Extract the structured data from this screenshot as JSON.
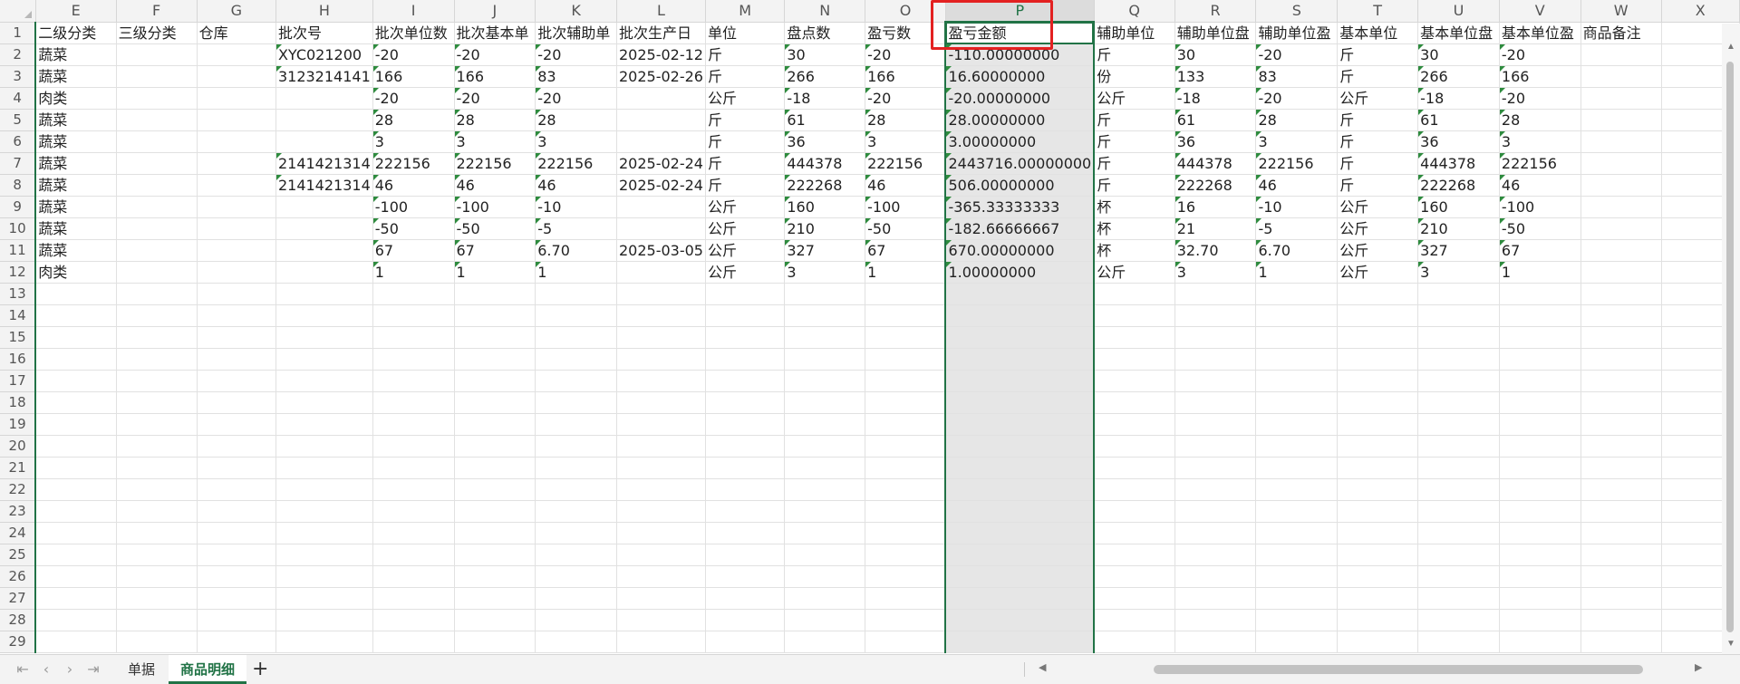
{
  "columns": [
    "E",
    "F",
    "G",
    "H",
    "I",
    "J",
    "K",
    "L",
    "M",
    "N",
    "O",
    "P",
    "Q",
    "R",
    "S",
    "T",
    "U",
    "V",
    "W",
    "X"
  ],
  "selected_column": "P",
  "header_row": [
    "二级分类",
    "三级分类",
    "仓库",
    "批次号",
    "批次单位数",
    "批次基本单",
    "批次辅助单",
    "批次生产日",
    "单位",
    "盘点数",
    "盈亏数",
    "盈亏金额",
    "辅助单位",
    "辅助单位盘",
    "辅助单位盈",
    "基本单位",
    "基本单位盘",
    "基本单位盈",
    "商品备注",
    ""
  ],
  "rows": [
    [
      "蔬菜",
      "",
      "",
      "XYC021200",
      "-20",
      "-20",
      "-20",
      "2025-02-12",
      "斤",
      "30",
      "-20",
      "-110.00000000",
      "斤",
      "30",
      "-20",
      "斤",
      "30",
      "-20",
      "",
      ""
    ],
    [
      "蔬菜",
      "",
      "",
      "3123214141",
      "166",
      "166",
      "83",
      "2025-02-26",
      "斤",
      "266",
      "166",
      "16.60000000",
      "份",
      "133",
      "83",
      "斤",
      "266",
      "166",
      "",
      ""
    ],
    [
      "肉类",
      "",
      "",
      "",
      "-20",
      "-20",
      "-20",
      "",
      "公斤",
      "-18",
      "-20",
      "-20.00000000",
      "公斤",
      "-18",
      "-20",
      "公斤",
      "-18",
      "-20",
      "",
      ""
    ],
    [
      "蔬菜",
      "",
      "",
      "",
      "28",
      "28",
      "28",
      "",
      "斤",
      "61",
      "28",
      "28.00000000",
      "斤",
      "61",
      "28",
      "斤",
      "61",
      "28",
      "",
      ""
    ],
    [
      "蔬菜",
      "",
      "",
      "",
      "3",
      "3",
      "3",
      "",
      "斤",
      "36",
      "3",
      "3.00000000",
      "斤",
      "36",
      "3",
      "斤",
      "36",
      "3",
      "",
      ""
    ],
    [
      "蔬菜",
      "",
      "",
      "2141421314",
      "222156",
      "222156",
      "222156",
      "2025-02-24",
      "斤",
      "444378",
      "222156",
      "2443716.00000000",
      "斤",
      "444378",
      "222156",
      "斤",
      "444378",
      "222156",
      "",
      ""
    ],
    [
      "蔬菜",
      "",
      "",
      "2141421314",
      "46",
      "46",
      "46",
      "2025-02-24",
      "斤",
      "222268",
      "46",
      "506.00000000",
      "斤",
      "222268",
      "46",
      "斤",
      "222268",
      "46",
      "",
      ""
    ],
    [
      "蔬菜",
      "",
      "",
      "",
      "-100",
      "-100",
      "-10",
      "",
      "公斤",
      "160",
      "-100",
      "-365.33333333",
      "杯",
      "16",
      "-10",
      "公斤",
      "160",
      "-100",
      "",
      ""
    ],
    [
      "蔬菜",
      "",
      "",
      "",
      "-50",
      "-50",
      "-5",
      "",
      "公斤",
      "210",
      "-50",
      "-182.66666667",
      "杯",
      "21",
      "-5",
      "公斤",
      "210",
      "-50",
      "",
      ""
    ],
    [
      "蔬菜",
      "",
      "",
      "",
      "67",
      "67",
      "6.70",
      "2025-03-05",
      "公斤",
      "327",
      "67",
      "670.00000000",
      "杯",
      "32.70",
      "6.70",
      "公斤",
      "327",
      "67",
      "",
      ""
    ],
    [
      "肉类",
      "",
      "",
      "",
      "1",
      "1",
      "1",
      "",
      "公斤",
      "3",
      "1",
      "1.00000000",
      "公斤",
      "3",
      "1",
      "公斤",
      "3",
      "1",
      "",
      ""
    ]
  ],
  "row_numbers": [
    "1",
    "2",
    "3",
    "4",
    "5",
    "6",
    "7",
    "8",
    "9",
    "10",
    "11",
    "12",
    "13",
    "14",
    "15",
    "16",
    "17",
    "18",
    "19",
    "20",
    "21",
    "22",
    "23",
    "24",
    "25",
    "26",
    "27",
    "28",
    "29"
  ],
  "sheet_tabs": [
    {
      "label": "单据",
      "active": false
    },
    {
      "label": "商品明细",
      "active": true
    }
  ],
  "add_sheet_label": "+",
  "colors": {
    "accent": "#217346",
    "highlight": "#e32121"
  }
}
